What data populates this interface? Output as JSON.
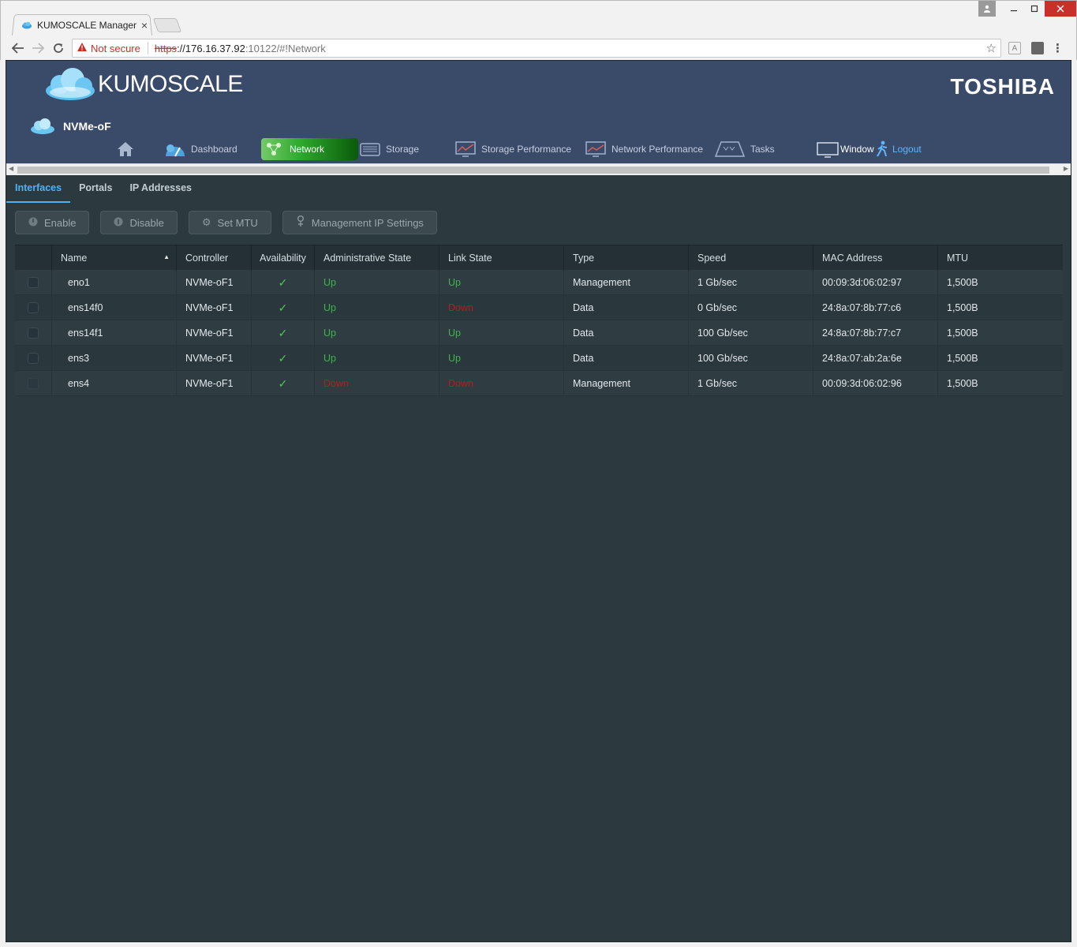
{
  "browser": {
    "tab_title": "KUMOSCALE Manager",
    "tab_close": "×",
    "not_secure": "Not secure",
    "url_scheme": "https",
    "url_host": "://176.16.37.92",
    "url_rest": ":10122/#!Network"
  },
  "app": {
    "brand": "KUMOSCALE",
    "vendor": "TOSHIBA",
    "cluster_name": "NVMe-oF"
  },
  "nav": {
    "dashboard": "Dashboard",
    "network": "Network",
    "storage": "Storage",
    "storage_performance": "Storage Performance",
    "network_performance": "Network Performance",
    "tasks": "Tasks",
    "window": "Window",
    "logout": "Logout"
  },
  "subtabs": [
    "Interfaces",
    "Portals",
    "IP Addresses"
  ],
  "actions": [
    "Enable",
    "Disable",
    "Set MTU",
    "Management IP Settings"
  ],
  "grid": {
    "columns": [
      "Name",
      "Controller",
      "Availability",
      "Administrative State",
      "Link State",
      "Type",
      "Speed",
      "MAC Address",
      "MTU"
    ],
    "rows": [
      {
        "name": "eno1",
        "controller": "NVMe-oF1",
        "availability": "✓",
        "admin": "Up",
        "link": "Up",
        "type": "Management",
        "speed": "1 Gb/sec",
        "mac": "00:09:3d:06:02:97",
        "mtu": "1,500B"
      },
      {
        "name": "ens14f0",
        "controller": "NVMe-oF1",
        "availability": "✓",
        "admin": "Up",
        "link": "Down",
        "type": "Data",
        "speed": "0 Gb/sec",
        "mac": "24:8a:07:8b:77:c6",
        "mtu": "1,500B"
      },
      {
        "name": "ens14f1",
        "controller": "NVMe-oF1",
        "availability": "✓",
        "admin": "Up",
        "link": "Up",
        "type": "Data",
        "speed": "100 Gb/sec",
        "mac": "24:8a:07:8b:77:c7",
        "mtu": "1,500B"
      },
      {
        "name": "ens3",
        "controller": "NVMe-oF1",
        "availability": "✓",
        "admin": "Up",
        "link": "Up",
        "type": "Data",
        "speed": "100 Gb/sec",
        "mac": "24:8a:07:ab:2a:6e",
        "mtu": "1,500B"
      },
      {
        "name": "ens4",
        "controller": "NVMe-oF1",
        "availability": "✓",
        "admin": "Down",
        "link": "Down",
        "type": "Management",
        "speed": "1 Gb/sec",
        "mac": "00:09:3d:06:02:96",
        "mtu": "1,500B"
      }
    ]
  },
  "colors": {
    "up": "#3fb34a",
    "down": "#c0171d",
    "accent": "#4fb3f0",
    "header": "#3a4b6a"
  }
}
